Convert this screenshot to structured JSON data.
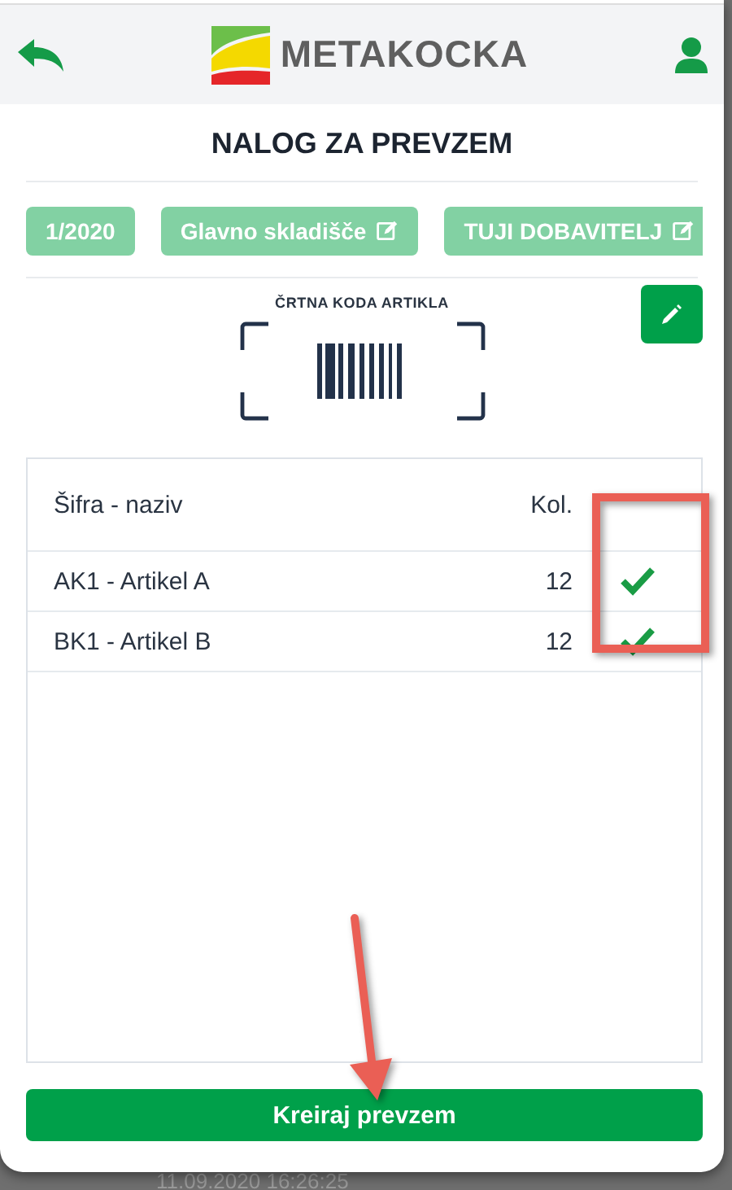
{
  "header": {
    "logo_text": "METAKOCKA"
  },
  "title": "NALOG ZA PREVZEM",
  "chips": [
    {
      "label": "1/2020",
      "editable": false
    },
    {
      "label": "Glavno skladišče",
      "editable": true
    },
    {
      "label": "TUJI DOBAVITELJ",
      "editable": true
    }
  ],
  "barcode": {
    "label": "ČRTNA KODA ARTIKLA"
  },
  "table": {
    "columns": [
      "Šifra - naziv",
      "Kol."
    ],
    "rows": [
      {
        "name": "AK1 - Artikel A",
        "qty": "12",
        "checked": true
      },
      {
        "name": "BK1 - Artikel B",
        "qty": "12",
        "checked": true
      }
    ]
  },
  "primary_button": "Kreiraj prevzem",
  "background_text": "11.09.2020 16:26:25",
  "annotations": {
    "highlight_box": {
      "color": "#ea5f55"
    },
    "arrow": {
      "color": "#ea5f55"
    }
  }
}
